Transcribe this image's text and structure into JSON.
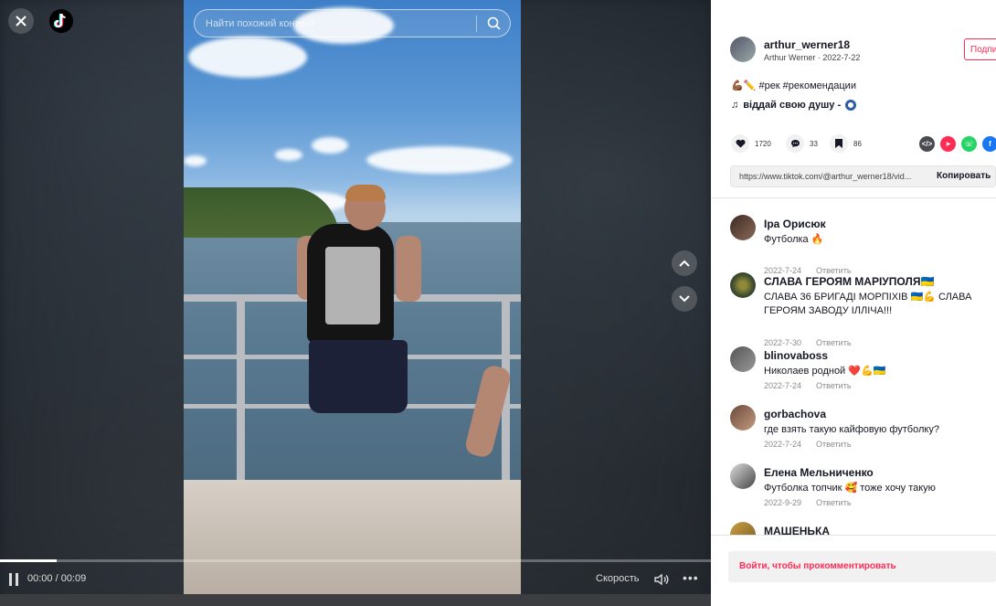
{
  "search": {
    "placeholder": "Найти похожий контент"
  },
  "player": {
    "time": "00:00 / 00:09",
    "speed_label": "Скорость",
    "progress": 0.08
  },
  "author": {
    "username": "arthur_werner18",
    "display": "Arthur Werner · 2022-7-22",
    "follow_label": "Подписаться"
  },
  "video": {
    "description": "#рек #рекомендации",
    "music": "віддай свою душу -",
    "likes": "1720",
    "comments": "33",
    "saves": "86",
    "link": "https://www.tiktok.com/@arthur_werner18/vid...",
    "copy_label": "Копировать"
  },
  "comments": [
    {
      "user": "Іра Орисюк",
      "text": "Футболка 🔥",
      "date": "2022-7-24",
      "reply": "Ответить"
    },
    {
      "user": "СЛАВА ГЕРОЯМ МАРІУПОЛЯ🇺🇦",
      "text": "СЛАВА 36 БРИГАДІ МОРПІХІВ 🇺🇦💪 СЛАВА ГЕРОЯМ ЗАВОДУ ІЛЛІЧА!!!",
      "date": "2022-7-30",
      "reply": "Ответить"
    },
    {
      "user": "blinovaboss",
      "text": "Николаев родной ❤️💪🇺🇦",
      "date": "2022-7-24",
      "reply": "Ответить"
    },
    {
      "user": "gorbachova",
      "text": "где взять такую кайфовую футболку?",
      "date": "2022-7-24",
      "reply": "Ответить"
    },
    {
      "user": "Елена Мельниченко",
      "text": "Футболка топчик 🥰 тоже хочу такую",
      "date": "2022-9-29",
      "reply": "Ответить"
    },
    {
      "user": "МАШЕНЬКА",
      "text": "",
      "date": "",
      "reply": ""
    }
  ],
  "footer": {
    "login_prompt": "Войти, чтобы прокомментировать"
  },
  "colors": {
    "accent": "#fe2c55",
    "panel_bg": "#ffffff"
  }
}
